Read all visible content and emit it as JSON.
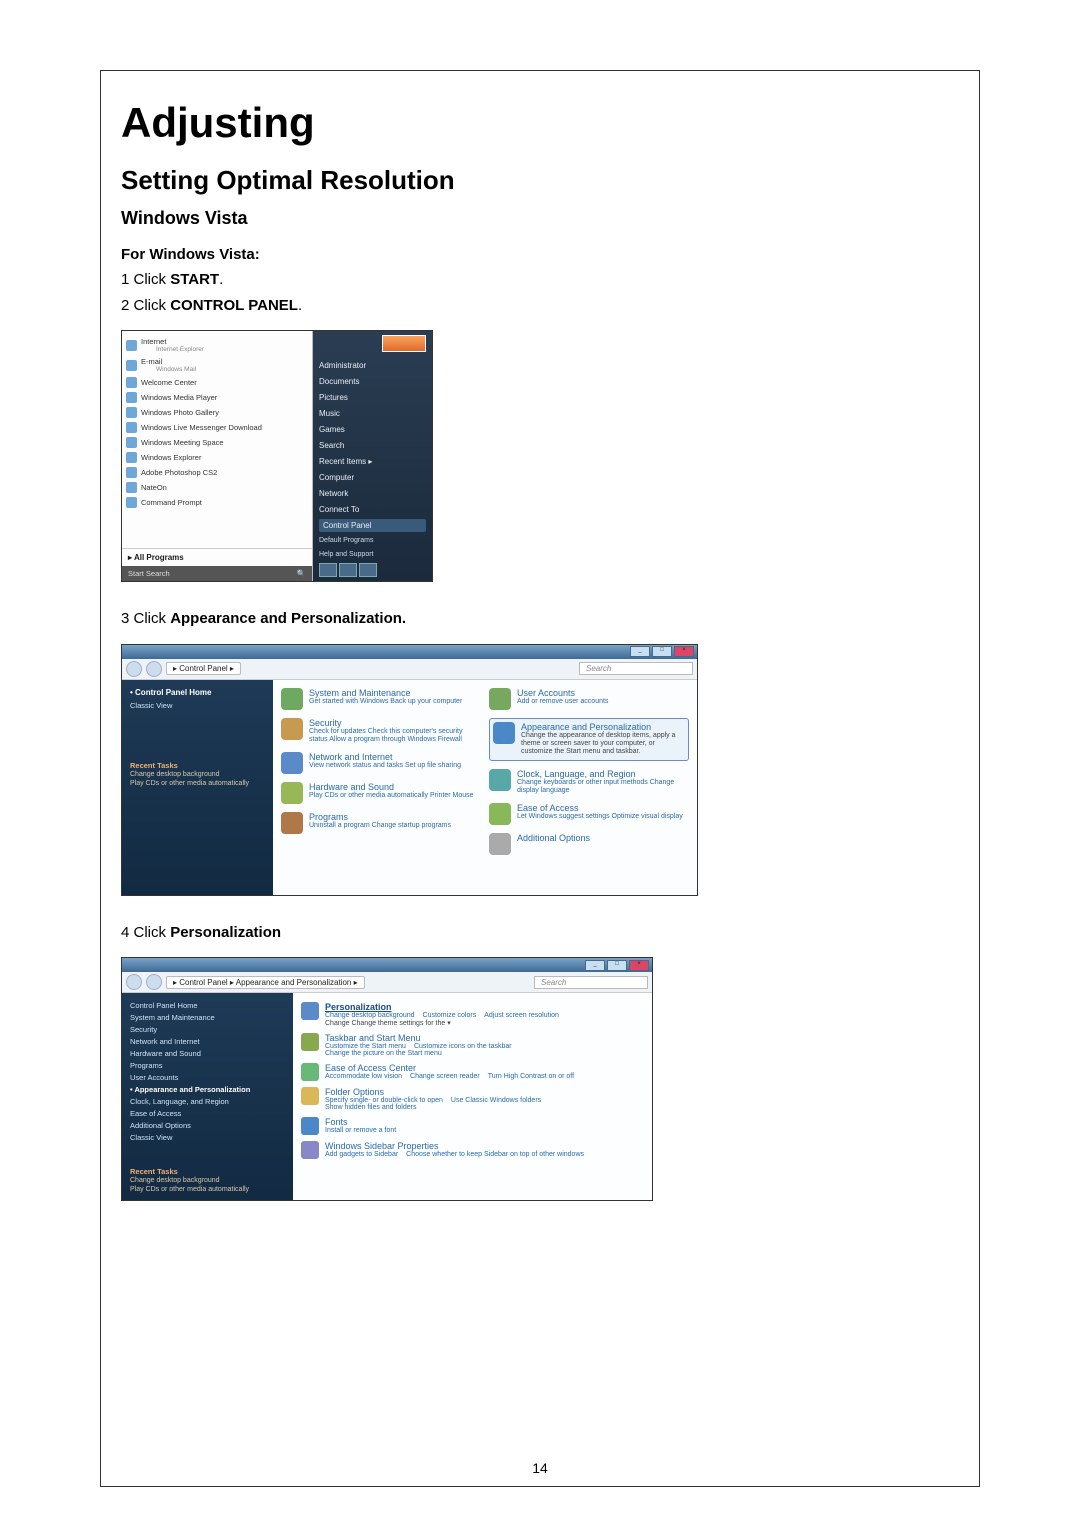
{
  "page": {
    "number": "14",
    "title": "Adjusting",
    "section": "Setting Optimal Resolution",
    "subsection": "Windows Vista",
    "intro_label": "For Windows Vista:",
    "step1_pre": "1 Click ",
    "step1_bold": "START",
    "step1_post": ".",
    "step2_pre": "2 Click ",
    "step2_bold": "CONTROL PANEL",
    "step2_post": ".",
    "step3_pre": "3 Click ",
    "step3_bold": "Appearance and Personalization.",
    "step4_pre": "4 Click ",
    "step4_bold": "Personalization"
  },
  "startmenu": {
    "left": [
      {
        "title": "Internet",
        "sub": "Internet Explorer"
      },
      {
        "title": "E-mail",
        "sub": "Windows Mail"
      },
      {
        "title": "Welcome Center",
        "sub": ""
      },
      {
        "title": "Windows Media Player",
        "sub": ""
      },
      {
        "title": "Windows Photo Gallery",
        "sub": ""
      },
      {
        "title": "Windows Live Messenger Download",
        "sub": ""
      },
      {
        "title": "Windows Meeting Space",
        "sub": ""
      },
      {
        "title": "Windows Explorer",
        "sub": ""
      },
      {
        "title": "Adobe Photoshop CS2",
        "sub": ""
      },
      {
        "title": "NateOn",
        "sub": ""
      },
      {
        "title": "Command Prompt",
        "sub": ""
      }
    ],
    "all_programs": "All Programs",
    "search": "Start Search",
    "right": {
      "user": "Administrator",
      "items": [
        "Documents",
        "Pictures",
        "Music",
        "Games",
        "Search",
        "Recent Items",
        "Computer",
        "Network",
        "Connect To"
      ],
      "control_panel": "Control Panel",
      "tail": [
        "Default Programs",
        "Help and Support"
      ]
    }
  },
  "cp1": {
    "breadcrumb": "▸ Control Panel ▸",
    "search_ph": "Search",
    "side": {
      "home": "Control Panel Home",
      "classic": "Classic View",
      "recent_hdr": "Recent Tasks",
      "recent1": "Change desktop background",
      "recent2": "Play CDs or other media automatically"
    },
    "cats_left": [
      {
        "t": "System and Maintenance",
        "d": "Get started with Windows\nBack up your computer"
      },
      {
        "t": "Security",
        "d": "Check for updates\nCheck this computer's security status\nAllow a program through Windows Firewall"
      },
      {
        "t": "Network and Internet",
        "d": "View network status and tasks\nSet up file sharing"
      },
      {
        "t": "Hardware and Sound",
        "d": "Play CDs or other media automatically\nPrinter\nMouse"
      },
      {
        "t": "Programs",
        "d": "Uninstall a program\nChange startup programs"
      }
    ],
    "cats_right": [
      {
        "t": "User Accounts",
        "d": "Add or remove user accounts"
      },
      {
        "t": "Appearance and Personalization",
        "d": "Change the appearance of desktop items, apply a theme or screen saver to your computer, or customize the Start menu and taskbar.",
        "hl": true
      },
      {
        "t": "Clock, Language, and Region",
        "d": "Change keyboards or other input methods\nChange display language"
      },
      {
        "t": "Ease of Access",
        "d": "Let Windows suggest settings\nOptimize visual display"
      },
      {
        "t": "Additional Options",
        "d": ""
      }
    ]
  },
  "cp2": {
    "breadcrumb": "▸ Control Panel ▸ Appearance and Personalization ▸",
    "search_ph": "Search",
    "side": [
      "Control Panel Home",
      "System and Maintenance",
      "Security",
      "Network and Internet",
      "Hardware and Sound",
      "Programs",
      "User Accounts",
      "Appearance and Personalization",
      "Clock, Language, and Region",
      "Ease of Access",
      "Additional Options",
      "Classic View"
    ],
    "recent_hdr": "Recent Tasks",
    "recent1": "Change desktop background",
    "recent2": "Play CDs or other media automatically",
    "items": [
      {
        "t": "Personalization",
        "hl": true,
        "lns": [
          "Change desktop background",
          "Customize colors",
          "Adjust screen resolution"
        ],
        "extra": "Change Change theme settings for the ▾"
      },
      {
        "t": "Taskbar and Start Menu",
        "lns": [
          "Customize the Start menu",
          "Customize icons on the taskbar",
          "Change the picture on the Start menu"
        ]
      },
      {
        "t": "Ease of Access Center",
        "lns": [
          "Accommodate low vision",
          "Change screen reader",
          "Turn High Contrast on or off"
        ]
      },
      {
        "t": "Folder Options",
        "lns": [
          "Specify single- or double-click to open",
          "Use Classic Windows folders",
          "Show hidden files and folders"
        ]
      },
      {
        "t": "Fonts",
        "lns": [
          "Install or remove a font"
        ]
      },
      {
        "t": "Windows Sidebar Properties",
        "lns": [
          "Add gadgets to Sidebar",
          "Choose whether to keep Sidebar on top of other windows"
        ]
      }
    ]
  }
}
